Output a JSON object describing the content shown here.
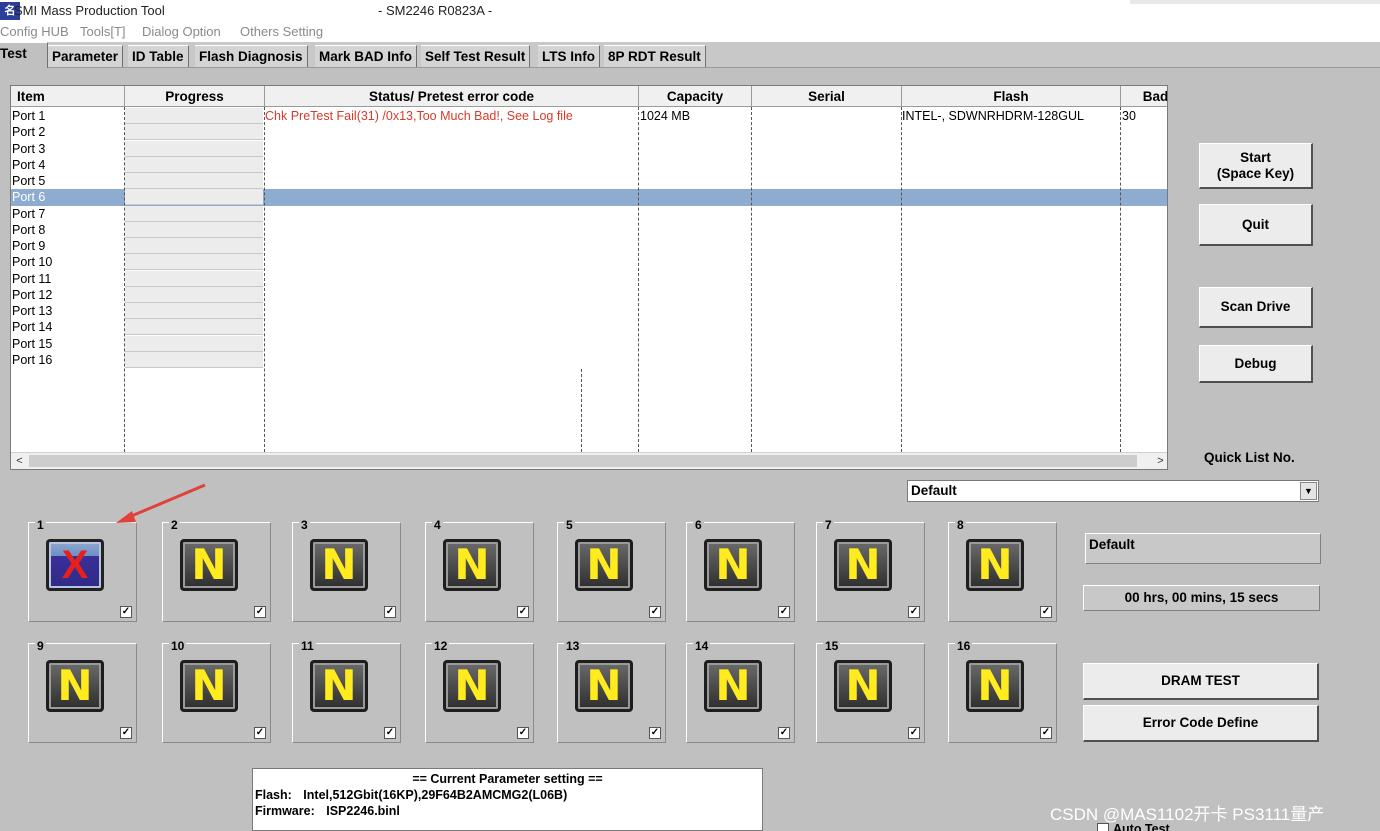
{
  "window": {
    "title": "SMI Mass Production Tool",
    "model": "- SM2246 R0823A -",
    "icon_text": "名称"
  },
  "menu": [
    "Config HUB",
    "Tools[T]",
    "Dialog Option",
    "Others Setting"
  ],
  "tabs": [
    "Test",
    "Parameter",
    "ID Table",
    "Flash Diagnosis",
    "Mark BAD Info",
    "Self Test Result",
    "LTS Info",
    "8P RDT Result"
  ],
  "active_tab": "Test",
  "grid": {
    "columns": [
      "Item",
      "Progress",
      "Status/ Pretest error code",
      "Capacity",
      "Serial",
      "Flash",
      "Bad"
    ],
    "rows": [
      {
        "port": "Port 1",
        "status": "Chk PreTest Fail(31) /0x13,Too Much Bad!, See Log file",
        "capacity": "1024 MB",
        "serial": "",
        "flash": "INTEL-, SDWNRHDRM-128GUL",
        "bad": "30"
      },
      {
        "port": "Port 2",
        "status": "",
        "capacity": "",
        "serial": "",
        "flash": "",
        "bad": ""
      },
      {
        "port": "Port 3",
        "status": "",
        "capacity": "",
        "serial": "",
        "flash": "",
        "bad": ""
      },
      {
        "port": "Port 4",
        "status": "",
        "capacity": "",
        "serial": "",
        "flash": "",
        "bad": ""
      },
      {
        "port": "Port 5",
        "status": "",
        "capacity": "",
        "serial": "",
        "flash": "",
        "bad": ""
      },
      {
        "port": "Port 6",
        "status": "",
        "capacity": "",
        "serial": "",
        "flash": "",
        "bad": "",
        "selected": true
      },
      {
        "port": "Port 7",
        "status": "",
        "capacity": "",
        "serial": "",
        "flash": "",
        "bad": ""
      },
      {
        "port": "Port 8",
        "status": "",
        "capacity": "",
        "serial": "",
        "flash": "",
        "bad": ""
      },
      {
        "port": "Port 9",
        "status": "",
        "capacity": "",
        "serial": "",
        "flash": "",
        "bad": ""
      },
      {
        "port": "Port 10",
        "status": "",
        "capacity": "",
        "serial": "",
        "flash": "",
        "bad": ""
      },
      {
        "port": "Port 11",
        "status": "",
        "capacity": "",
        "serial": "",
        "flash": "",
        "bad": ""
      },
      {
        "port": "Port 12",
        "status": "",
        "capacity": "",
        "serial": "",
        "flash": "",
        "bad": ""
      },
      {
        "port": "Port 13",
        "status": "",
        "capacity": "",
        "serial": "",
        "flash": "",
        "bad": ""
      },
      {
        "port": "Port 14",
        "status": "",
        "capacity": "",
        "serial": "",
        "flash": "",
        "bad": ""
      },
      {
        "port": "Port 15",
        "status": "",
        "capacity": "",
        "serial": "",
        "flash": "",
        "bad": ""
      },
      {
        "port": "Port 16",
        "status": "",
        "capacity": "",
        "serial": "",
        "flash": "",
        "bad": ""
      }
    ]
  },
  "buttons": {
    "start_line1": "Start",
    "start_line2": "(Space Key)",
    "quit": "Quit",
    "scan_drive": "Scan Drive",
    "debug": "Debug",
    "dram_test": "DRAM TEST",
    "error_code_define": "Error Code Define"
  },
  "quick_list": {
    "label": "Quick List No.",
    "selected": "Default"
  },
  "profile_name": "Default",
  "elapsed": "00 hrs, 00 mins, 15 secs",
  "slots": [
    {
      "num": "1",
      "state": "fail",
      "glyph": "X",
      "checked": true
    },
    {
      "num": "2",
      "state": "idle",
      "glyph": "N",
      "checked": true
    },
    {
      "num": "3",
      "state": "idle",
      "glyph": "N",
      "checked": true
    },
    {
      "num": "4",
      "state": "idle",
      "glyph": "N",
      "checked": true
    },
    {
      "num": "5",
      "state": "idle",
      "glyph": "N",
      "checked": true
    },
    {
      "num": "6",
      "state": "idle",
      "glyph": "N",
      "checked": true
    },
    {
      "num": "7",
      "state": "idle",
      "glyph": "N",
      "checked": true
    },
    {
      "num": "8",
      "state": "idle",
      "glyph": "N",
      "checked": true
    },
    {
      "num": "9",
      "state": "idle",
      "glyph": "N",
      "checked": true
    },
    {
      "num": "10",
      "state": "idle",
      "glyph": "N",
      "checked": true
    },
    {
      "num": "11",
      "state": "idle",
      "glyph": "N",
      "checked": true
    },
    {
      "num": "12",
      "state": "idle",
      "glyph": "N",
      "checked": true
    },
    {
      "num": "13",
      "state": "idle",
      "glyph": "N",
      "checked": true
    },
    {
      "num": "14",
      "state": "idle",
      "glyph": "N",
      "checked": true
    },
    {
      "num": "15",
      "state": "idle",
      "glyph": "N",
      "checked": true
    },
    {
      "num": "16",
      "state": "idle",
      "glyph": "N",
      "checked": true
    }
  ],
  "parameter_box": {
    "title": "== Current Parameter setting ==",
    "flash_label": "Flash:",
    "flash_value": "Intel,512Gbit(16KP),29F64B2AMCMG2(L06B)",
    "firmware_label": "Firmware:",
    "firmware_value": "ISP2246.binl"
  },
  "auto_test_label": "Auto Test",
  "watermark": "CSDN @MAS1102开卡 PS3111量产",
  "colors": {
    "window_bg": "#c0c0c0",
    "error_text": "#d83a2a",
    "selected_row": "#8eacd0",
    "idle_glyph": "#ffeb1e",
    "fail_glyph": "#e8201c",
    "annotation_arrow": "#e0413a"
  }
}
